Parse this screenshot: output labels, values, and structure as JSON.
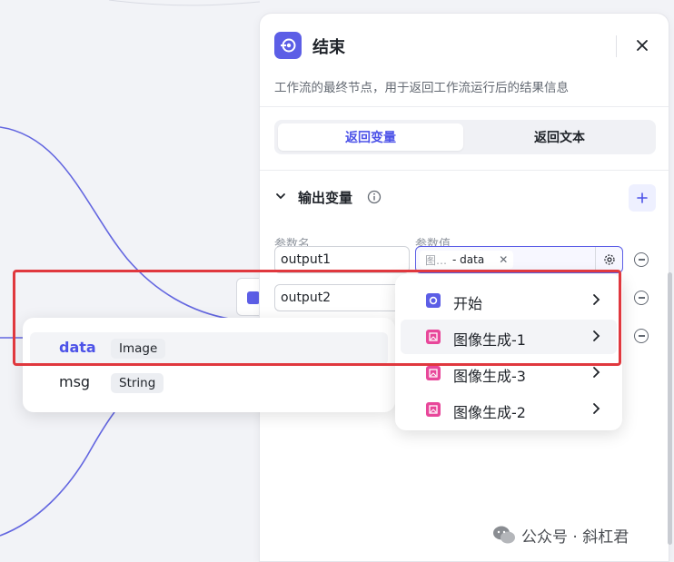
{
  "colors": {
    "accent": "#4d53e8",
    "node_start": "#5c5ee6",
    "node_image": "#e8479a",
    "highlight_border": "#e0383e"
  },
  "panel": {
    "title": "结束",
    "description": "工作流的最终节点，用于返回工作流运行后的结果信息",
    "icon": "end-node-icon",
    "tabs": [
      {
        "label": "返回变量",
        "active": true
      },
      {
        "label": "返回文本",
        "active": false
      }
    ],
    "section": {
      "title": "输出变量",
      "col_name_label": "参数名",
      "col_value_label": "参数值"
    },
    "rows": [
      {
        "name": "output1",
        "ref_prefix": "图…",
        "ref_var": "- data"
      },
      {
        "name": "output2"
      }
    ]
  },
  "var_popup": {
    "items": [
      {
        "name": "data",
        "type": "Image",
        "selected": true
      },
      {
        "name": "msg",
        "type": "String",
        "selected": false
      }
    ]
  },
  "source_popup": {
    "items": [
      {
        "label": "开始",
        "icon": "start-node-icon"
      },
      {
        "label": "图像生成-1",
        "icon": "image-gen-icon"
      },
      {
        "label": "图像生成-3",
        "icon": "image-gen-icon"
      },
      {
        "label": "图像生成-2",
        "icon": "image-gen-icon"
      }
    ]
  },
  "watermark": {
    "text": "公众号 · 斜杠君"
  }
}
